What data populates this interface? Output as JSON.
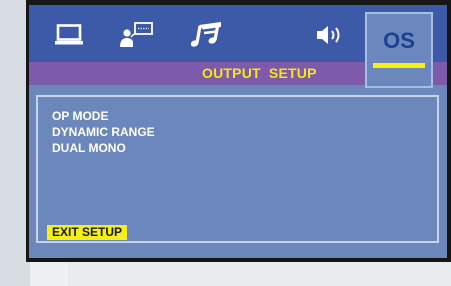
{
  "tabs": [
    {
      "id": "general",
      "icon": "monitor-icon"
    },
    {
      "id": "speaker",
      "icon": "presenter-icon"
    },
    {
      "id": "audio",
      "icon": "music-note-icon"
    },
    {
      "id": "volume",
      "icon": "speaker-volume-icon"
    },
    {
      "id": "output",
      "icon": "os-text-icon",
      "label": "OS",
      "selected": true
    }
  ],
  "section_title": "OUTPUT  SETUP",
  "menu": {
    "items": [
      {
        "label": "OP MODE"
      },
      {
        "label": "DYNAMIC RANGE"
      },
      {
        "label": "DUAL MONO"
      }
    ]
  },
  "exit_label": "EXIT SETUP",
  "colors": {
    "tabbar": "#3c5aa7",
    "panel": "#6c87bb",
    "subbar": "#7e5baa",
    "highlight": "#f7ef1a",
    "os_text": "#1d3f95"
  }
}
